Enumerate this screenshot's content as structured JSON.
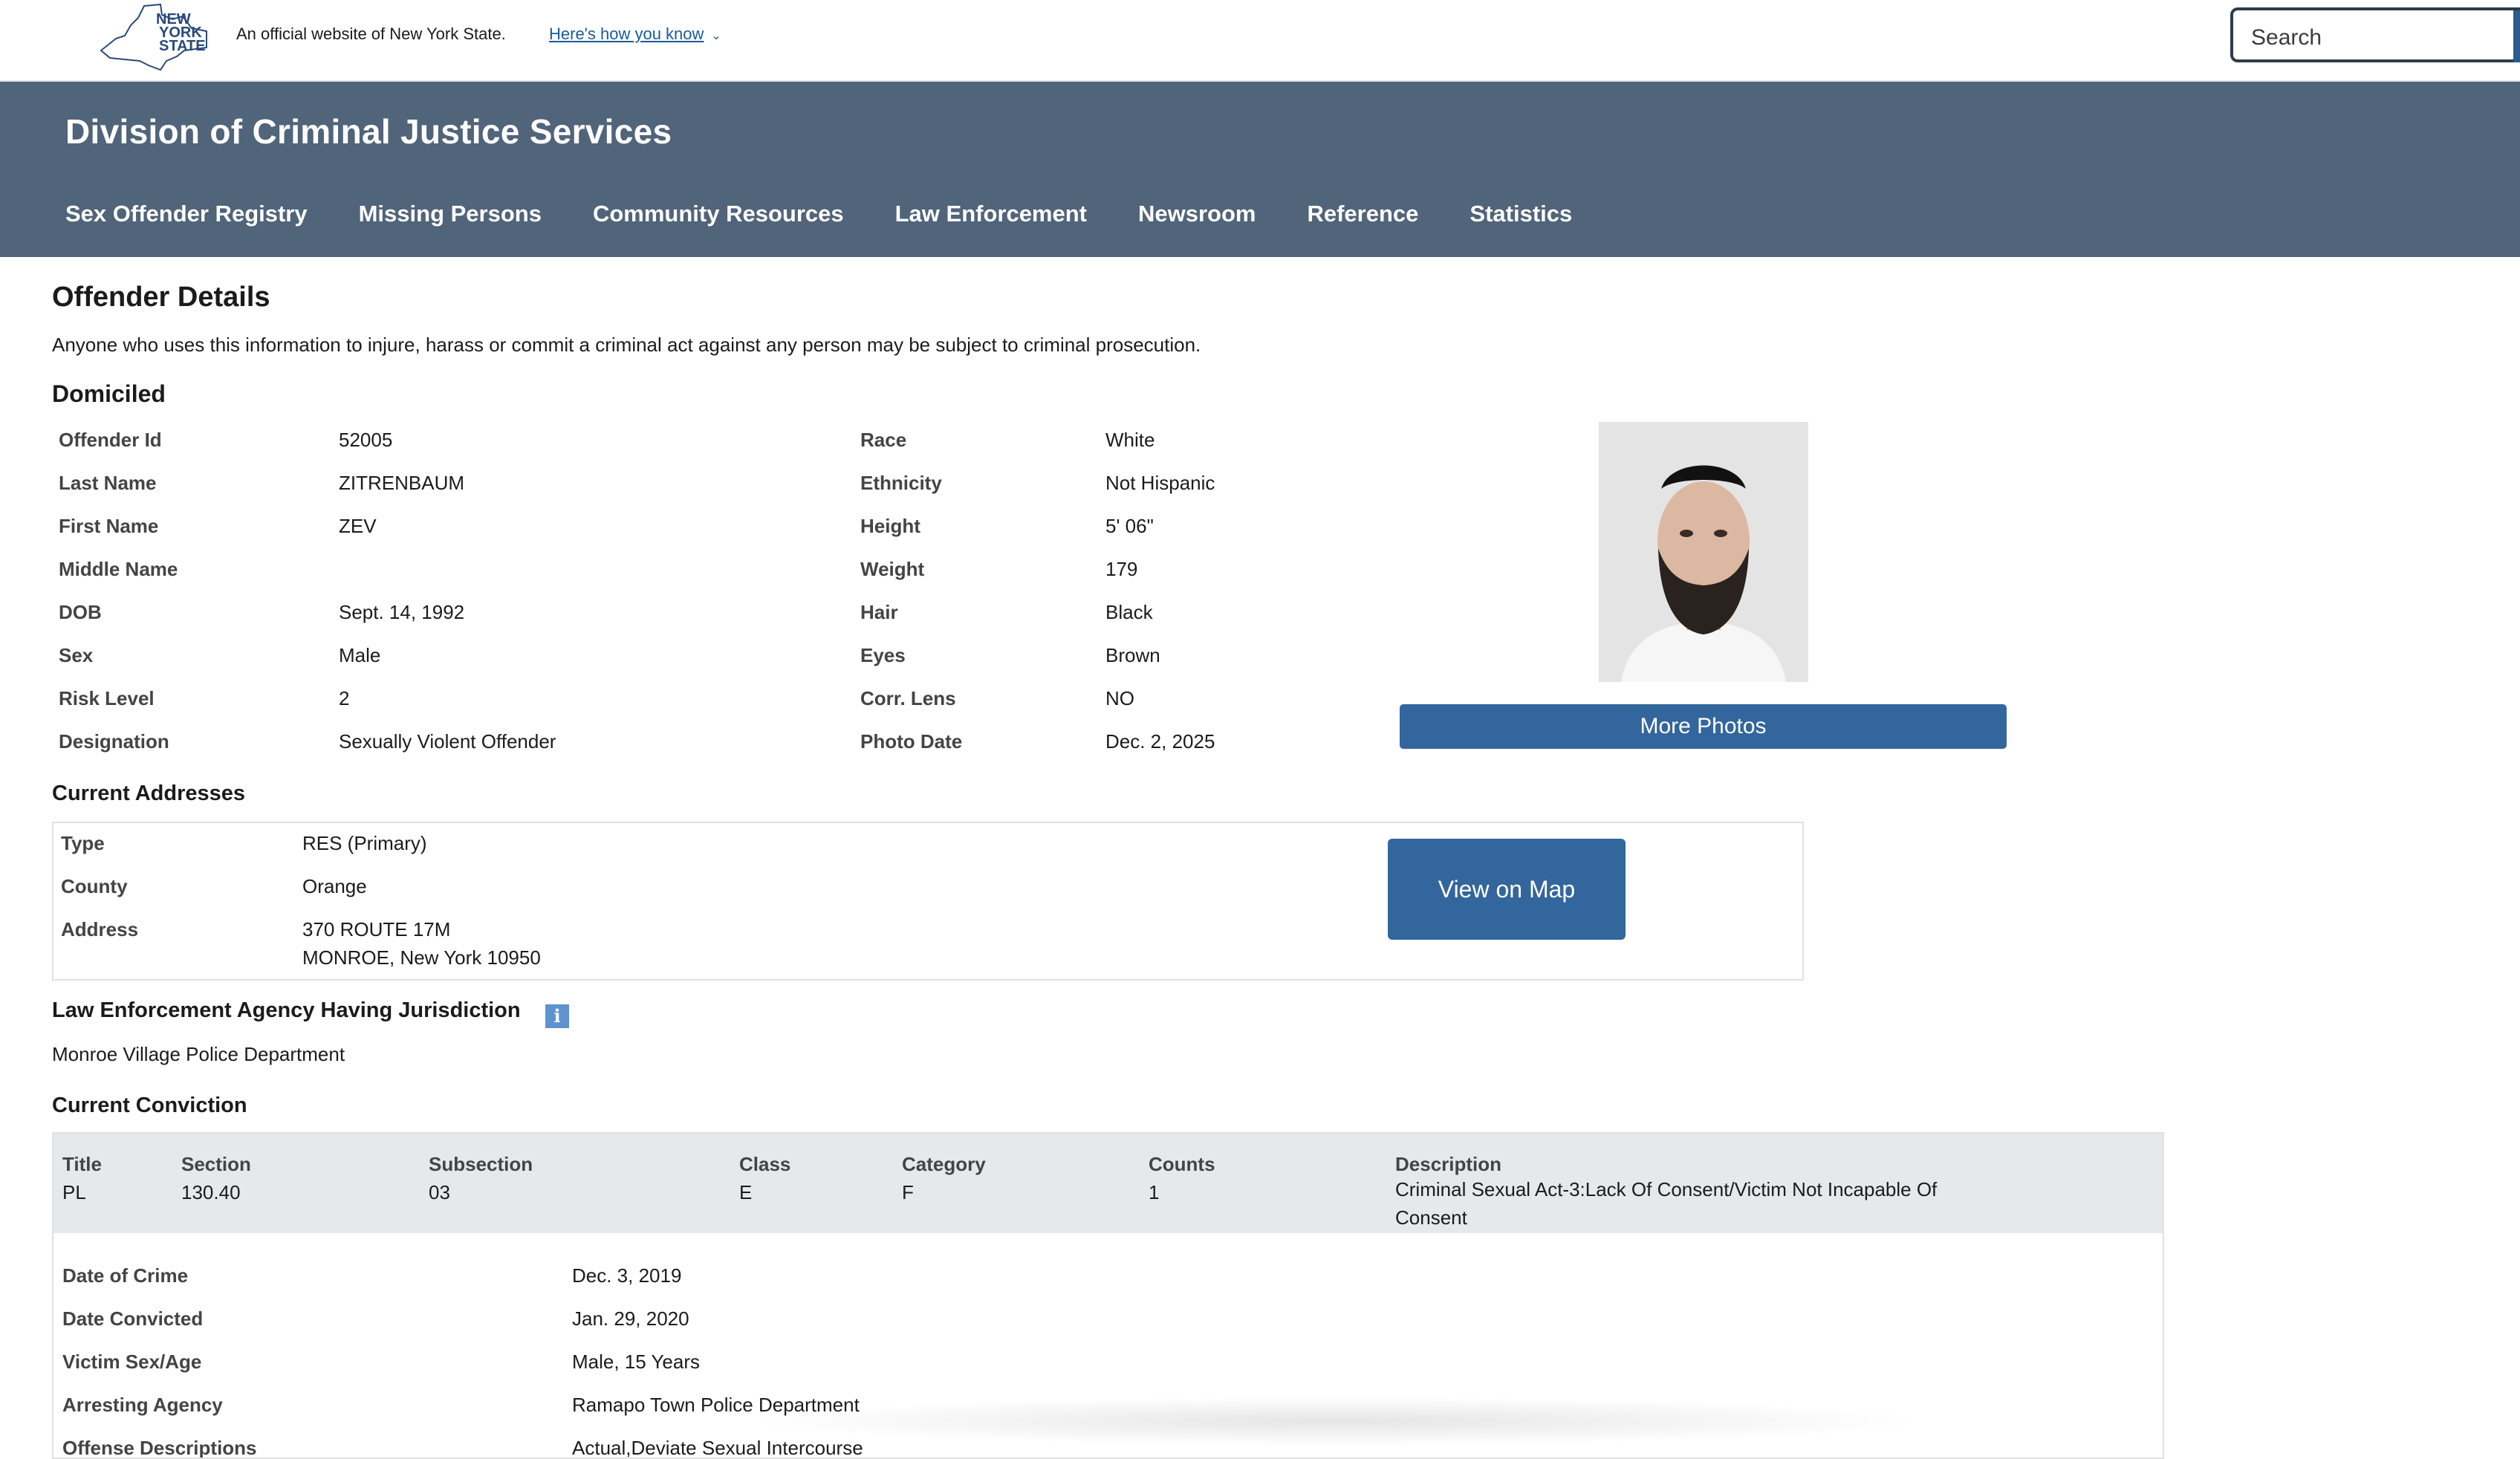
{
  "banner": {
    "logo_lines": [
      "NEW",
      "YORK",
      "STATE"
    ],
    "official_text": "An official website of New York State.",
    "how_link": "Here's how you know",
    "search_placeholder": "Search"
  },
  "agency": {
    "title": "Division of Criminal Justice Services",
    "nav": [
      "Sex Offender Registry",
      "Missing Persons",
      "Community Resources",
      "Law Enforcement",
      "Newsroom",
      "Reference",
      "Statistics"
    ]
  },
  "page": {
    "title": "Offender Details",
    "disclaimer": "Anyone who uses this information to injure, harass or commit a criminal act against any person may be subject to criminal prosecution.",
    "status": "Domiciled"
  },
  "details_left": [
    {
      "label": "Offender Id",
      "value": "52005"
    },
    {
      "label": "Last Name",
      "value": "ZITRENBAUM"
    },
    {
      "label": "First Name",
      "value": "ZEV"
    },
    {
      "label": "Middle Name",
      "value": ""
    },
    {
      "label": "DOB",
      "value": "Sept. 14, 1992"
    },
    {
      "label": "Sex",
      "value": "Male"
    },
    {
      "label": "Risk Level",
      "value": "2"
    },
    {
      "label": "Designation",
      "value": "Sexually Violent Offender"
    }
  ],
  "details_right": [
    {
      "label": "Race",
      "value": "White"
    },
    {
      "label": "Ethnicity",
      "value": "Not Hispanic"
    },
    {
      "label": "Height",
      "value": "5' 06\""
    },
    {
      "label": "Weight",
      "value": "179"
    },
    {
      "label": "Hair",
      "value": "Black"
    },
    {
      "label": "Eyes",
      "value": "Brown"
    },
    {
      "label": "Corr. Lens",
      "value": "NO"
    },
    {
      "label": "Photo Date",
      "value": "Dec. 2, 2025"
    }
  ],
  "photo": {
    "more_photos_label": "More Photos"
  },
  "addresses": {
    "heading": "Current Addresses",
    "rows": [
      {
        "label": "Type",
        "value": "RES (Primary)"
      },
      {
        "label": "County",
        "value": "Orange"
      },
      {
        "label": "Address",
        "value": "370 ROUTE 17M",
        "value2": "MONROE, New York 10950"
      }
    ],
    "map_button": "View on Map"
  },
  "jurisdiction": {
    "heading": "Law Enforcement Agency Having Jurisdiction",
    "info_icon": "i",
    "agency": "Monroe Village Police Department"
  },
  "conviction": {
    "heading": "Current Conviction",
    "columns": [
      {
        "header": "Title",
        "value": "PL"
      },
      {
        "header": "Section",
        "value": "130.40"
      },
      {
        "header": "Subsection",
        "value": "03"
      },
      {
        "header": "Class",
        "value": "E"
      },
      {
        "header": "Category",
        "value": "F"
      },
      {
        "header": "Counts",
        "value": "1"
      },
      {
        "header": "Description",
        "value": "Criminal Sexual Act-3:Lack Of Consent/Victim Not Incapable Of Consent"
      }
    ],
    "details": [
      {
        "label": "Date of Crime",
        "value": "Dec. 3, 2019"
      },
      {
        "label": "Date Convicted",
        "value": "Jan. 29, 2020"
      },
      {
        "label": "Victim Sex/Age",
        "value": "Male, 15 Years"
      },
      {
        "label": "Arresting Agency",
        "value": "Ramapo Town Police Department"
      },
      {
        "label": "Offense Descriptions",
        "value": "Actual,Deviate Sexual Intercourse"
      }
    ]
  },
  "colors": {
    "header_bg": "#50647a",
    "button_bg": "#33669c",
    "link": "#1a5a9a"
  }
}
